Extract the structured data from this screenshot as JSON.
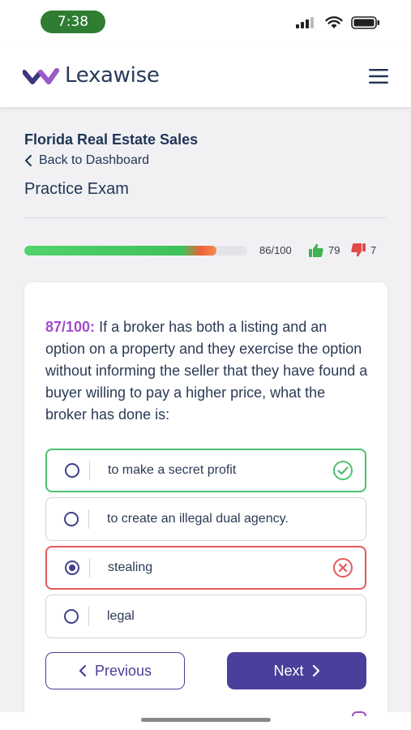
{
  "status_bar": {
    "time": "7:38"
  },
  "header": {
    "brand": "Lexawise"
  },
  "page": {
    "course_title": "Florida Real Estate Sales",
    "back_label": "Back to Dashboard",
    "section_title": "Practice Exam"
  },
  "progress": {
    "completed_fraction": 0.86,
    "label": "86/100",
    "thumbs_up": "79",
    "thumbs_down": "7"
  },
  "question": {
    "number": "87/100:",
    "text": "If a broker has both a listing and an option on a property and they exercise the option without informing the seller that they have found a buyer willing to pay a higher price, what the broker has done is:",
    "options": [
      {
        "label": "to make a secret profit",
        "state": "correct",
        "selected": false
      },
      {
        "label": "to create an illegal dual agency.",
        "state": "neutral",
        "selected": false
      },
      {
        "label": "stealing",
        "state": "wrong",
        "selected": true
      },
      {
        "label": "legal",
        "state": "neutral",
        "selected": false
      }
    ]
  },
  "nav": {
    "previous_label": "Previous",
    "next_label": "Next"
  },
  "colors": {
    "accent": "#4a3f9a",
    "question_number": "#a04dc8",
    "correct": "#4cbf6e",
    "wrong": "#e35a5a",
    "time_pill": "#2e7d32"
  },
  "icons": [
    "signal-icon",
    "wifi-icon",
    "battery-icon",
    "menu-icon",
    "chevron-left-icon",
    "thumbs-up-icon",
    "thumbs-down-icon",
    "check-circle-icon",
    "x-circle-icon",
    "chevron-right-icon"
  ]
}
